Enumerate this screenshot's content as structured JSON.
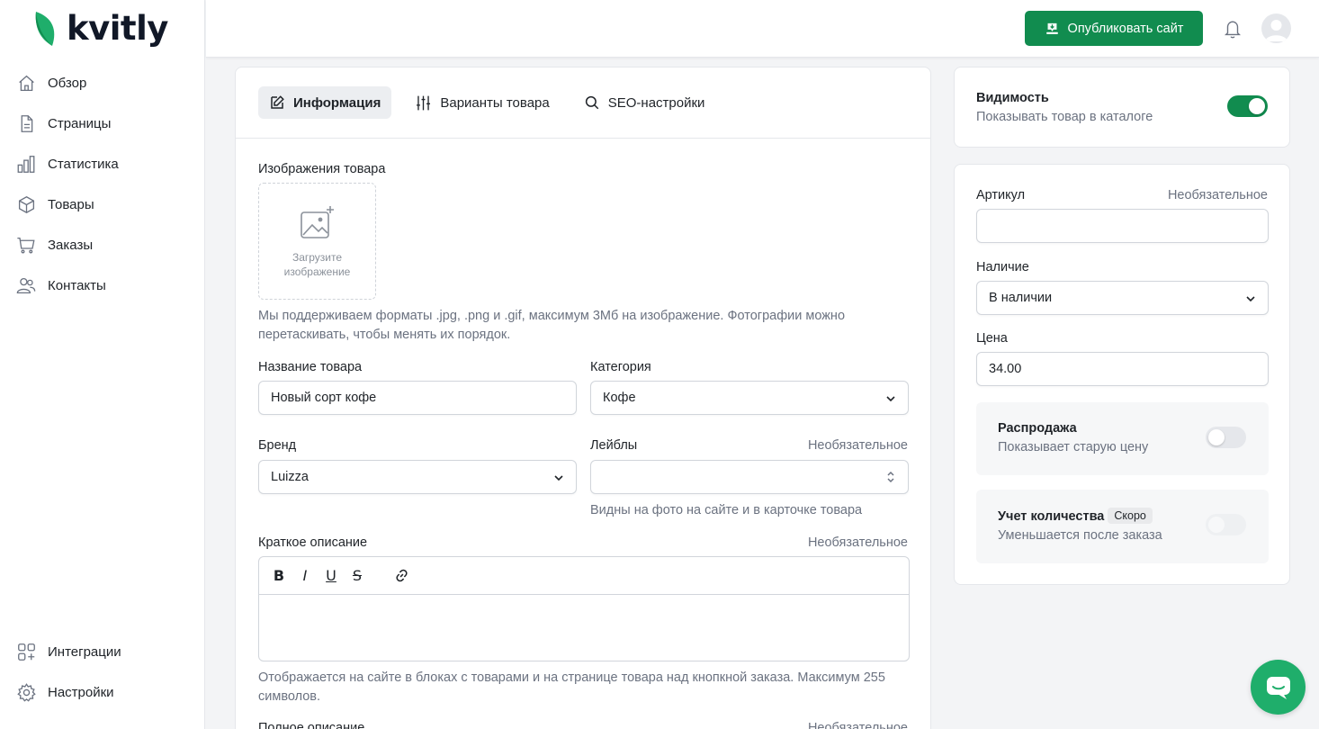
{
  "brand": {
    "name": "kvitly",
    "accent": "#118c4f"
  },
  "sidebar": {
    "items": [
      {
        "label": "Обзор",
        "icon": "home-icon"
      },
      {
        "label": "Страницы",
        "icon": "file-icon"
      },
      {
        "label": "Статистика",
        "icon": "bar-chart-icon"
      },
      {
        "label": "Товары",
        "icon": "box-icon"
      },
      {
        "label": "Заказы",
        "icon": "cart-icon"
      },
      {
        "label": "Контакты",
        "icon": "users-icon"
      }
    ],
    "bottom_items": [
      {
        "label": "Интеграции",
        "icon": "grid-plus-icon"
      },
      {
        "label": "Настройки",
        "icon": "gear-icon"
      }
    ]
  },
  "header": {
    "publish_label": "Опубликовать сайт"
  },
  "tabs": [
    {
      "label": "Информация",
      "active": true
    },
    {
      "label": "Варианты товара",
      "active": false
    },
    {
      "label": "SEO-настройки",
      "active": false
    }
  ],
  "form": {
    "images_label": "Изображения товара",
    "upload_text_1": "Загрузите",
    "upload_text_2": "изображение",
    "images_hint": "Мы поддерживаем форматы .jpg, .png и .gif, максимум 3Мб на изображение. Фотографии можно перетаскивать, чтобы менять их порядок.",
    "name_label": "Название товара",
    "name_value": "Новый сорт кофе",
    "category_label": "Категория",
    "category_value": "Кофе",
    "brand_label": "Бренд",
    "brand_value": "Luizza",
    "labels_label": "Лейблы",
    "optional": "Необязательное",
    "labels_hint": "Видны на фото на сайте и в карточке товара",
    "short_desc_label": "Краткое описание",
    "toolbar": {
      "bold": "B",
      "italic": "I",
      "underline": "U",
      "strike": "S"
    },
    "short_desc_hint": "Отображается на сайте в блоках с товарами и на странице товара над кнопкной заказа. Максимум 255 символов.",
    "full_desc_label": "Полное описание"
  },
  "visibility": {
    "title": "Видимость",
    "subtitle": "Показывать товар в каталоге",
    "on": true
  },
  "props": {
    "sku_label": "Артикул",
    "optional": "Необязательное",
    "sku_value": "",
    "stock_label": "Наличие",
    "stock_value": "В наличии",
    "price_label": "Цена",
    "price_value": "34.00",
    "sale": {
      "title": "Распродажа",
      "subtitle": "Показывает старую цену",
      "on": false
    },
    "quantity": {
      "title": "Учет количества",
      "badge": "Скоро",
      "subtitle": "Уменьшается после заказа",
      "on": false
    }
  }
}
